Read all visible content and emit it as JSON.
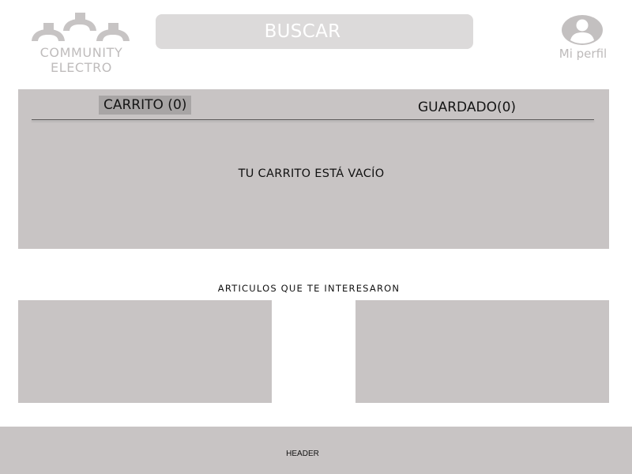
{
  "header": {
    "logo": {
      "line1": "COMMUNITY",
      "line2": "ELECTRO",
      "icon": "community-people-icon",
      "color": "#bfbcbc"
    },
    "search": {
      "label": "BUSCAR",
      "icon": "none"
    },
    "profile": {
      "label": "Mi perfil",
      "icon": "user-avatar-icon"
    }
  },
  "cart": {
    "tabs": [
      {
        "label": "CARRITO (0)",
        "active": true
      },
      {
        "label": "GUARDADO(0)",
        "active": false
      }
    ],
    "empty_message": "TU CARRITO ESTÁ VACÍO"
  },
  "recommendations": {
    "title": "ARTICULOS QUE TE INTERESARON",
    "cards": [
      {
        "placeholder": true
      },
      {
        "placeholder": true
      }
    ]
  },
  "footer": {
    "label": "HEADER"
  },
  "colors": {
    "panel": "#c8c4c4",
    "search_bg": "#dcdada",
    "active_tab": "#a8a5a5",
    "muted_text": "#bfbcbc",
    "text": "#111111"
  }
}
